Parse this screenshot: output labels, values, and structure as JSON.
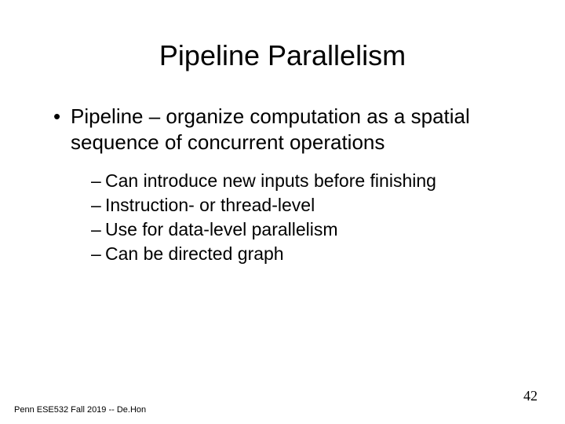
{
  "title": "Pipeline Parallelism",
  "main_bullet": "Pipeline – organize computation as a spatial sequence of concurrent operations",
  "sub_bullets": {
    "item0": "Can introduce new inputs before finishing",
    "item1": "Instruction- or thread-level",
    "item2": "Use for data-level parallelism",
    "item3": "Can be directed graph"
  },
  "footer": "Penn ESE532 Fall 2019 -- De.Hon",
  "page_number": "42"
}
